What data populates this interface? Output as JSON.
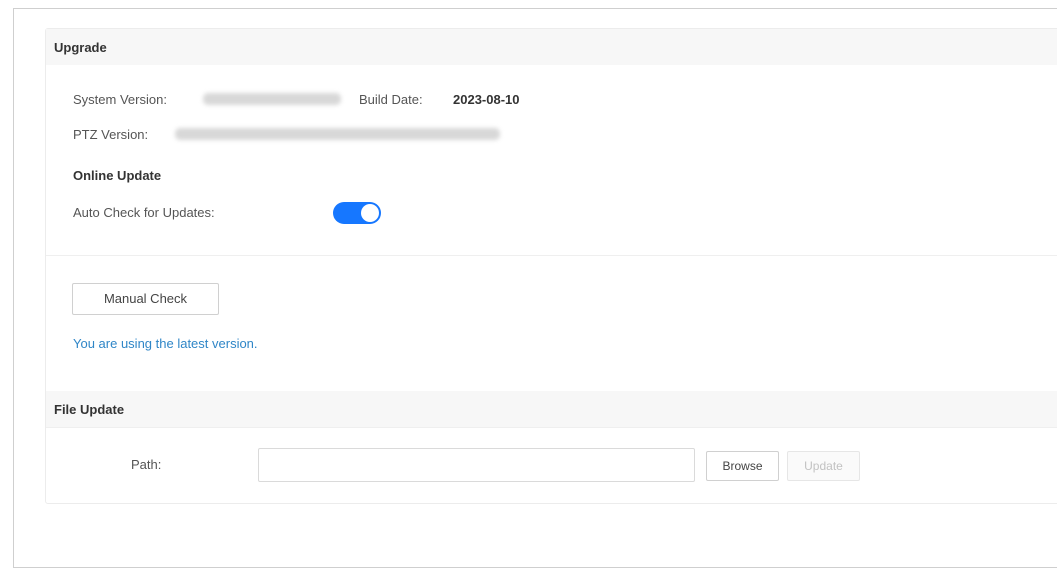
{
  "upgrade": {
    "title": "Upgrade",
    "system_version_label": "System Version:",
    "build_date_label": "Build Date:",
    "build_date_value": "2023-08-10",
    "ptz_version_label": "PTZ Version:"
  },
  "online_update": {
    "title": "Online Update",
    "auto_check_label": "Auto Check for Updates:",
    "auto_check_enabled": true,
    "manual_check_label": "Manual Check",
    "status_text": "You are using the latest version."
  },
  "file_update": {
    "title": "File Update",
    "path_label": "Path:",
    "path_value": "",
    "browse_label": "Browse",
    "update_label": "Update"
  },
  "colors": {
    "accent": "#1677ff",
    "status_text": "#2f86c7",
    "header_bg": "#f7f7f7"
  }
}
